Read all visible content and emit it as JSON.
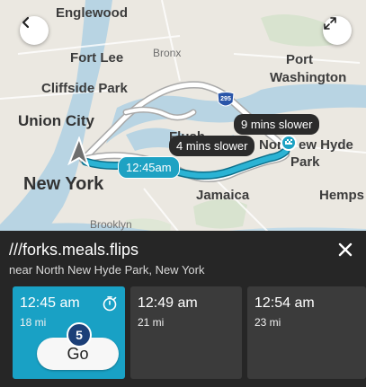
{
  "map": {
    "places": [
      {
        "label": "Englewood",
        "key": "englewood"
      },
      {
        "label": "Bronx",
        "key": "bronx"
      },
      {
        "label": "Fort Lee",
        "key": "fort-lee"
      },
      {
        "label": "Port",
        "key": "port"
      },
      {
        "label": "Washington",
        "key": "washington"
      },
      {
        "label": "Cliffside Park",
        "key": "cliffside-park"
      },
      {
        "label": "Union City",
        "key": "union-city"
      },
      {
        "label": "New York",
        "key": "new-york"
      },
      {
        "label": "Flush",
        "key": "flushing"
      },
      {
        "label": "Nor",
        "key": "north"
      },
      {
        "label": "ew Hyde",
        "key": "new-hyde"
      },
      {
        "label": "Park",
        "key": "park"
      },
      {
        "label": "Jamaica",
        "key": "jamaica"
      },
      {
        "label": "Hemps",
        "key": "hempstead"
      },
      {
        "label": "Brooklyn",
        "key": "brooklyn"
      }
    ],
    "highway_shield": "295",
    "route_labels": {
      "slower_9": "9 mins slower",
      "slower_4": "4 mins slower",
      "eta_main": "12:45am"
    }
  },
  "destination": {
    "title": "///forks.meals.flips",
    "subtitle": "near North New Hyde Park, New York"
  },
  "routes": [
    {
      "time": "12:45 am",
      "distance": "18 mi",
      "selected": true,
      "badge": "5",
      "go_label": "Go"
    },
    {
      "time": "12:49 am",
      "distance": "21 mi",
      "selected": false
    },
    {
      "time": "12:54 am",
      "distance": "23 mi",
      "selected": false
    }
  ],
  "icons": {
    "back": "chevron-left-icon",
    "expand": "expand-icon",
    "close": "close-icon",
    "timer": "stopwatch-icon",
    "destination": "flag-pin-icon",
    "position": "current-location-arrow-icon"
  },
  "colors": {
    "route_selected": "#1ea2c3",
    "route_alt": "#ffffff",
    "panel_bg": "#262626",
    "card_active": "#19a1c5",
    "card_inactive": "#3b3b3b",
    "water": "#b8d4e3"
  }
}
